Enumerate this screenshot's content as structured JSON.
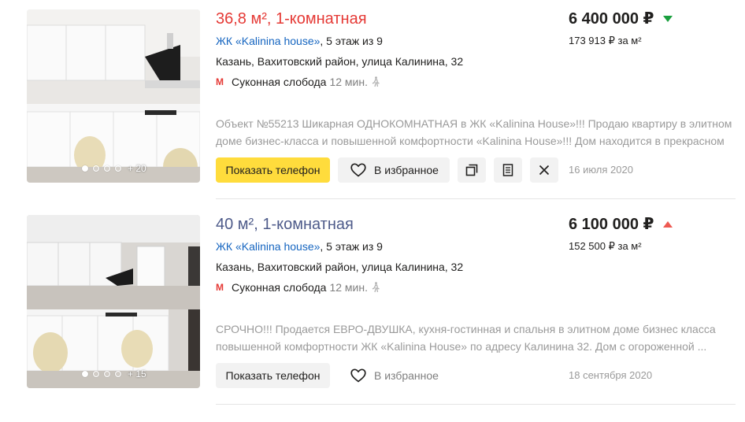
{
  "listings": [
    {
      "title": "36,8 м², 1-комнатная",
      "complex_link": "ЖК «Kalinina house»",
      "floor": ", 5 этаж из 9",
      "address": "Казань, Вахитовский район, улица Калинина, 32",
      "metro_icon": "М",
      "metro_station": "Суконная слобода",
      "metro_time": "12 мин.",
      "price": "6 400 000 ₽",
      "price_trend": "down",
      "price_per_m": "173 913 ₽ за м²",
      "description": "Объект №55213 Шикарная ОДНОКОМНАТНАЯ в ЖК «Kalinina House»!!! Продаю квартиру в элитном доме бизнес-класса и повышенной комфортности «Kalinina House»!!! Дом находится в прекрасном ...",
      "photo_more": "+ 20",
      "phone_button": "Показать телефон",
      "favorite_button": "В избранное",
      "date": "16 июля 2020"
    },
    {
      "title": "40 м², 1-комнатная",
      "complex_link": "ЖК «Kalinina house»",
      "floor": ", 5 этаж из 9",
      "address": "Казань, Вахитовский район, улица Калинина, 32",
      "metro_icon": "М",
      "metro_station": "Суконная слобода",
      "metro_time": "12 мин.",
      "price": "6 100 000 ₽",
      "price_trend": "up",
      "price_per_m": "152 500 ₽ за м²",
      "description": "СРОЧНО!!! Продается ЕВРО-ДВУШКА, кухня-гостинная и спальня в элитном доме бизнес класса повышенной комфортности ЖК «Kalinina House» по адресу Калинина 32. Дом с огороженной ...",
      "photo_more": "+ 15",
      "phone_button": "Показать телефон",
      "favorite_button": "В избранное",
      "date": "18 сентября 2020"
    }
  ],
  "colors": {
    "title_new": "#e53935",
    "title_visited": "#4e5b8a",
    "link": "#1565c0",
    "price_down": "#1a9f3e",
    "price_up": "#ee5a52",
    "phone_primary": "#ffdc3c"
  },
  "icons": [
    "heart-icon",
    "copy-icon",
    "note-icon",
    "close-icon",
    "walk-icon",
    "metro-icon"
  ]
}
